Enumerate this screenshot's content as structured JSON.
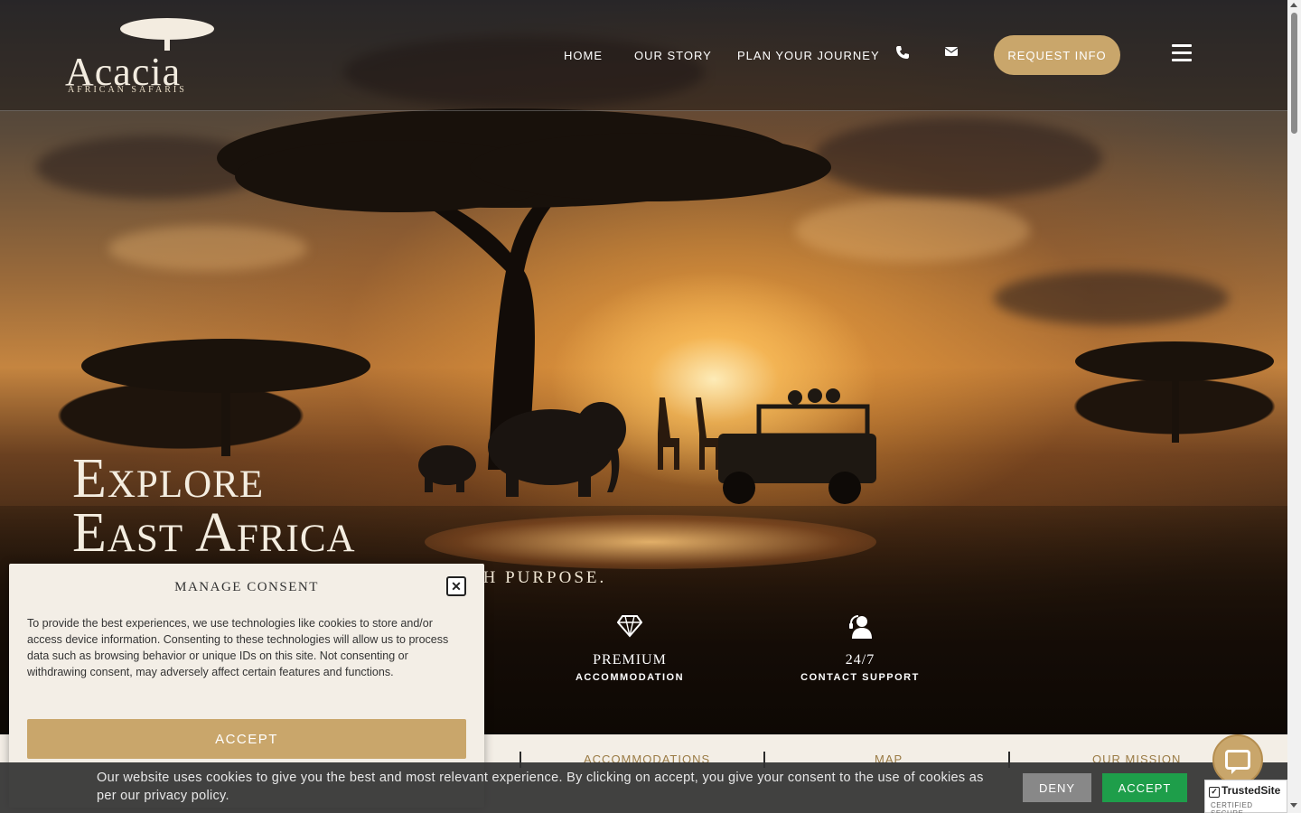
{
  "brand": {
    "name": "Acacia",
    "tagline": "African Safaris"
  },
  "nav": {
    "items": [
      "HOME",
      "OUR STORY",
      "PLAN YOUR JOURNEY"
    ],
    "phone_icon": "phone-icon",
    "email_icon": "envelope-icon",
    "cta_label": "REQUEST INFO",
    "menu_icon": "hamburger-icon"
  },
  "hero": {
    "title_line1": "Explore",
    "title_line2": "East Africa",
    "subtitle": "TH PURPOSE.",
    "features": [
      {
        "icon": "diamond-icon",
        "title": "PREMIUM",
        "label": "ACCOMMODATION"
      },
      {
        "icon": "support-agent-icon",
        "title": "24/7",
        "label": "CONTACT SUPPORT"
      }
    ]
  },
  "subnav": {
    "items": [
      "ACCOMMODATIONS",
      "MAP",
      "OUR MISSION"
    ]
  },
  "consent": {
    "title": "MANAGE CONSENT",
    "body": "To provide the best experiences, we use technologies like cookies to store and/or access device information. Consenting to these technologies will allow us to process data such as browsing behavior or unique IDs on this site. Not consenting or withdrawing consent, may adversely affect certain features and functions.",
    "accept_label": "ACCEPT",
    "close_icon": "close-icon"
  },
  "cookie_bar": {
    "text": "Our website uses cookies to give you the best and most relevant experience. By clicking on accept, you give your consent to the use of cookies as per our privacy policy.",
    "deny_label": "DENY",
    "accept_label": "ACCEPT"
  },
  "trusted_site": {
    "name": "TrustedSite",
    "sub": "CERTIFIED SECURE"
  },
  "colors": {
    "accent": "#c9a66b",
    "accept_green": "#1e9e4a",
    "deny_gray": "#888888",
    "subnav_text": "#9a7b45"
  }
}
